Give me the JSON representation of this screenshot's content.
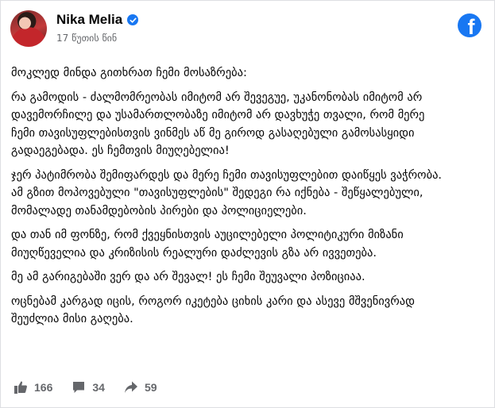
{
  "post": {
    "author": "Nika Melia",
    "verified": true,
    "timestamp": "17 წუთის წინ",
    "paragraphs": [
      "მოკლედ მინდა გითხრათ ჩემი მოსაზრება:",
      "რა გამოდის - ძალმომრეობას იმიტომ არ შევეგუე, უკანონობას იმიტომ არ დავემორჩილე და უსამართლობაზე იმიტომ არ დავხუჭე თვალი, რომ მერე ჩემი თავისუფლებისთვის ვინმეს აწ მე გიროდ გასაღებული გამოსასყიდი გადაეგებადა. ეს ჩემთვის მიუღებელია!",
      "ჯერ პატიმრობა შემიფარდეს და მერე ჩემი თავისუფლებით დაიწყეს ვაჭრობა. ამ გზით მოპოვებული \"თავისუფლების\" შედეგი რა იქნება - შეწყალებული, მომალადე თანამდებობის პირები და პოლიციელები.",
      "და თან იმ ფონზე, რომ ქვეყნისთვის აუცილებელი პოლიტიკური მიზანი მიუღწეველია და კრიზისის რეალური დაძლევის გზა არ ივვეთება.",
      "მე ამ გარიგებაში ვერ და არ შევალ! ეს ჩემი შეუვალი პოზიციაა.",
      "ოცნებამ კარგად იცის, როგორ იკეტება ციხის კარი და ასევე მშვენივრად შეუძლია მისი გაღება."
    ]
  },
  "stats": {
    "likes": "166",
    "comments": "34",
    "shares": "59"
  },
  "colors": {
    "facebook_blue": "#1877f2",
    "meta_text": "#65676b"
  },
  "icons": [
    "facebook-logo-icon",
    "verified-badge-icon",
    "like-icon",
    "comment-icon",
    "share-icon"
  ]
}
